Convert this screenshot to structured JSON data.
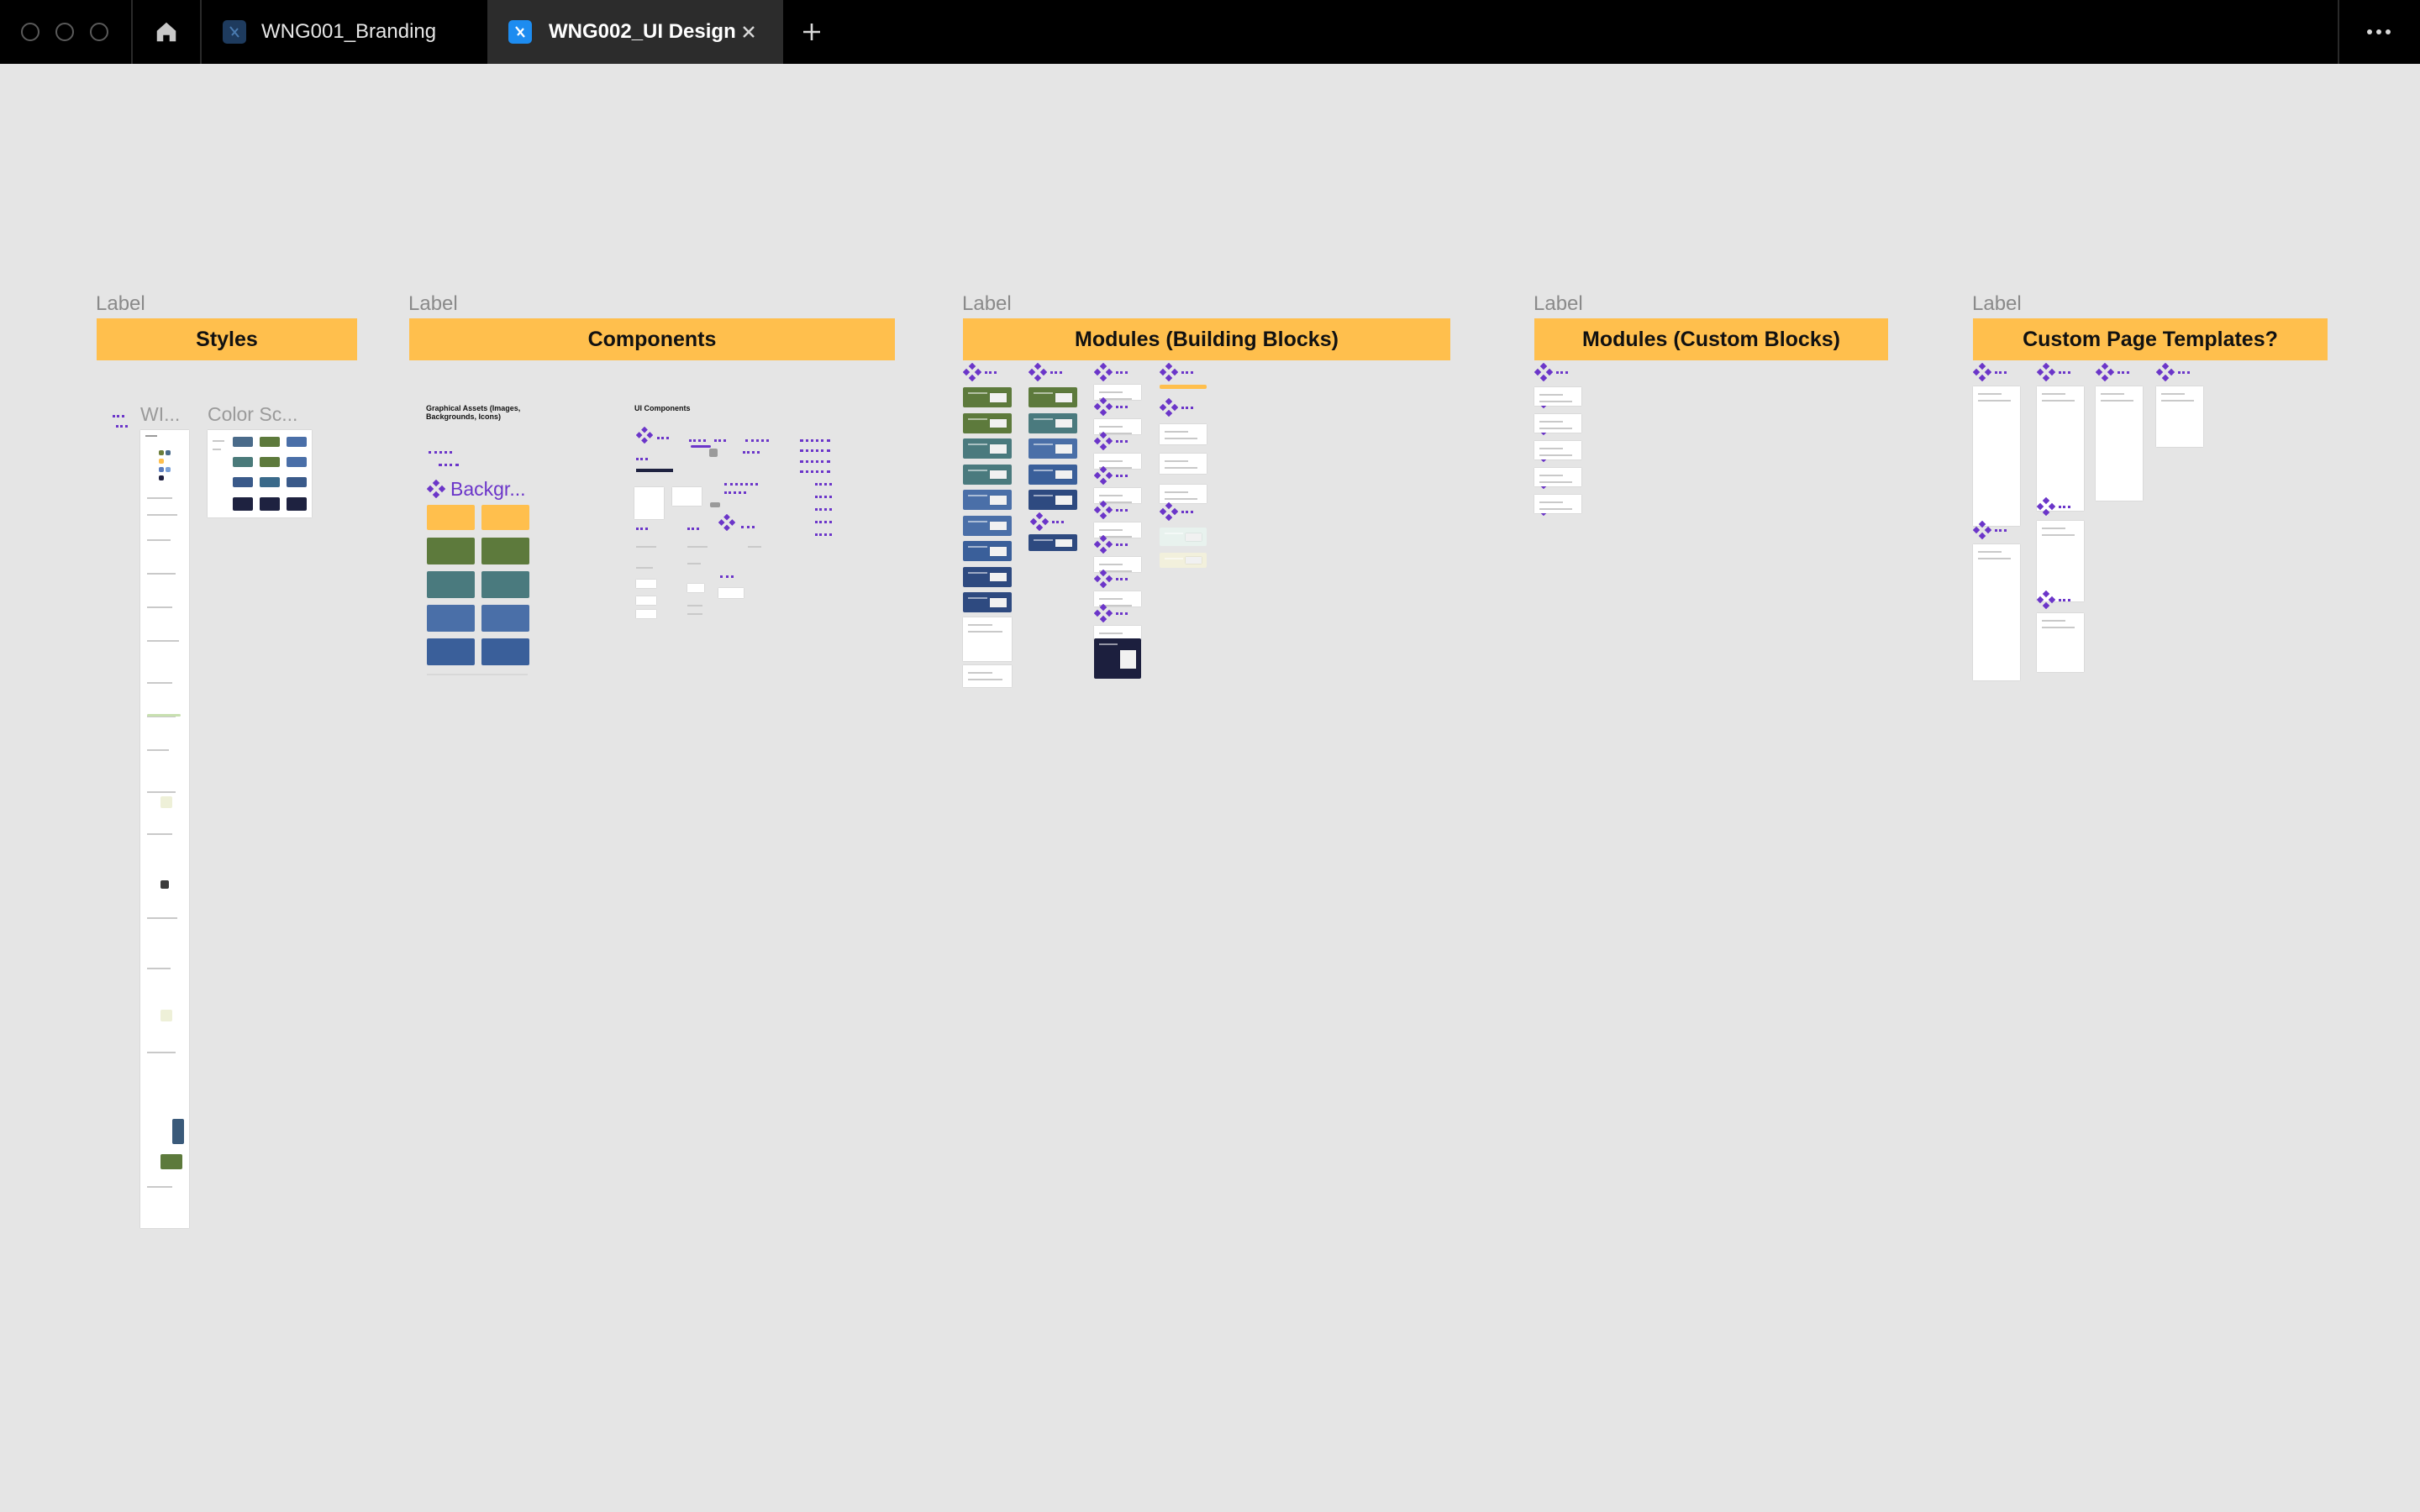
{
  "tabs": [
    {
      "label": "WNG001_Branding",
      "active": false
    },
    {
      "label": "WNG002_UI Design",
      "active": true
    }
  ],
  "icons": {
    "home": "home-icon",
    "close": "close-icon",
    "add": "plus-icon",
    "more": "more-horizontal-icon",
    "component": "component-diamond-icon"
  },
  "colors": {
    "section_bar": "#ffbf4d",
    "component_purple": "#6b35c9",
    "canvas": "#e5e5e5",
    "titlebar": "#000000"
  },
  "sections": [
    {
      "label": "Label",
      "title": "Styles"
    },
    {
      "label": "Label",
      "title": "Components"
    },
    {
      "label": "Label",
      "title": "Modules (Building Blocks)"
    },
    {
      "label": "Label",
      "title": "Modules (Custom Blocks)"
    },
    {
      "label": "Label",
      "title": "Custom Page Templates?"
    }
  ],
  "styles": {
    "frame_wi": "WI...",
    "frame_color": "Color Sc..."
  },
  "components": {
    "graphical_assets_title": "Graphical Assets (Images, Backgrounds, Icons)",
    "ui_components_title": "UI Components",
    "backgrounds_label": "Backgr..."
  }
}
